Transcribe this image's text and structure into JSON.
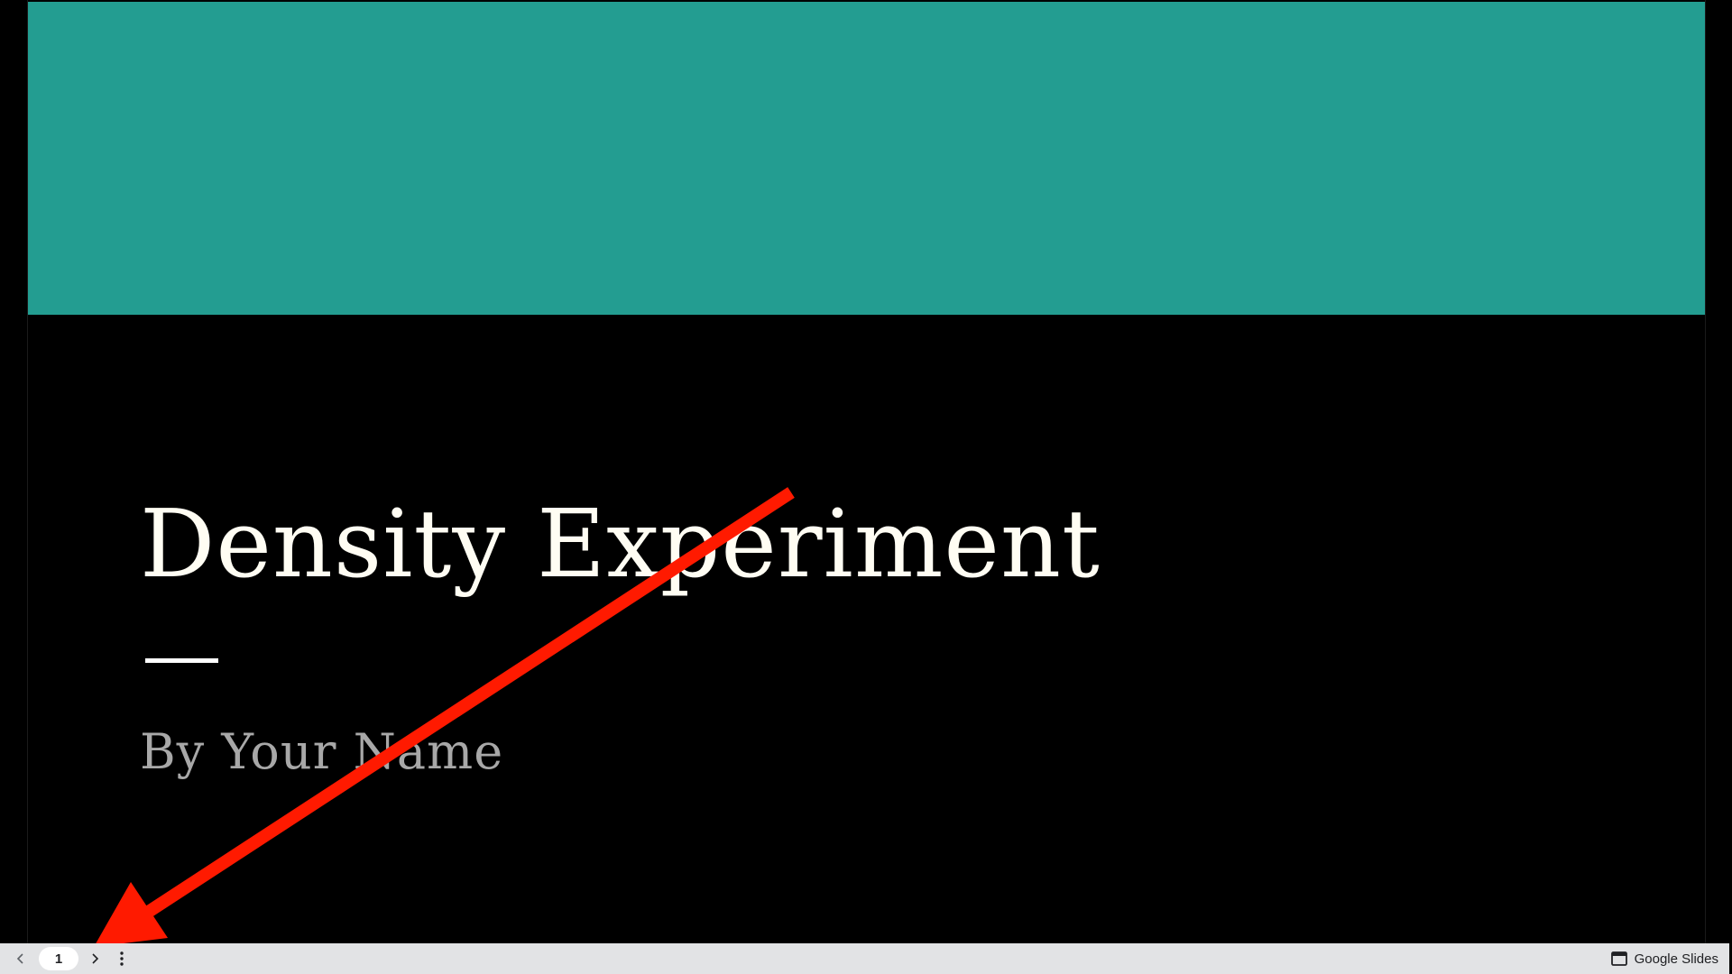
{
  "slide": {
    "title": "Density Experiment",
    "subtitle": "By Your Name",
    "banner_color": "#239d91",
    "background_color": "#000000"
  },
  "annotation": {
    "type": "arrow",
    "color": "#ff1a00"
  },
  "toolbar": {
    "prev_icon": "chevron-left-icon",
    "page_number": "1",
    "next_icon": "chevron-right-icon",
    "more_icon": "more-vert-icon",
    "brand_icon": "slides-icon",
    "brand_label": "Google Slides"
  }
}
